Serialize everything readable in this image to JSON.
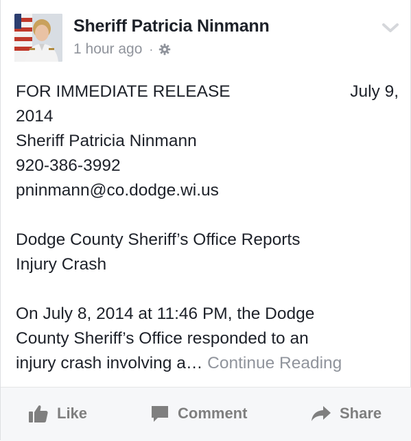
{
  "post": {
    "author": "Sheriff Patricia Ninmann",
    "timestamp": "1 hour ago",
    "separator": "·",
    "privacy_icon": "gear-icon",
    "menu_icon": "chevron-down-icon",
    "body": {
      "release_label": "FOR IMMEDIATE RELEASE",
      "release_date_part1": "July 9,",
      "release_date_part2": "2014",
      "contact_name": "Sheriff Patricia Ninmann",
      "contact_phone": "920-386-3992",
      "contact_email": "pninmann@co.dodge.wi.us",
      "headline_line1": "Dodge County Sheriff’s Office Reports",
      "headline_line2": "Injury Crash",
      "paragraph_line1": "On July 8, 2014 at 11:46 PM, the Dodge",
      "paragraph_line2": "County Sheriff’s Office responded to an",
      "paragraph_line3": "injury crash involving a…",
      "continue_link": "Continue Reading"
    }
  },
  "actions": {
    "like_label": "Like",
    "comment_label": "Comment",
    "share_label": "Share",
    "like_icon": "thumbs-up-icon",
    "comment_icon": "comment-icon",
    "share_icon": "share-arrow-icon"
  },
  "colors": {
    "text_primary": "#1d2129",
    "text_secondary": "#90949c",
    "action_text": "#7f7f7f",
    "action_bar_bg": "#f6f7f9"
  }
}
